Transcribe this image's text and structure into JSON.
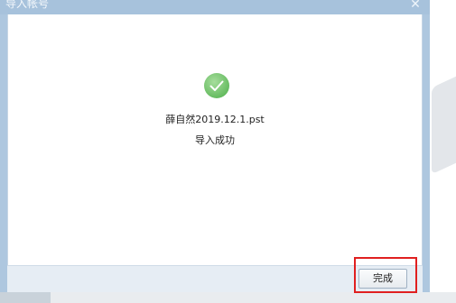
{
  "dialog": {
    "title": "导入帐号",
    "close_icon": "close-icon"
  },
  "content": {
    "status_icon": "check-circle-icon",
    "file_name": "薛自然2019.12.1.pst",
    "status_text": "导入成功"
  },
  "footer": {
    "done_label": "完成"
  },
  "colors": {
    "success_green": "#7cc576",
    "title_bar": "#a7c2dc",
    "highlight": "#e02020"
  }
}
